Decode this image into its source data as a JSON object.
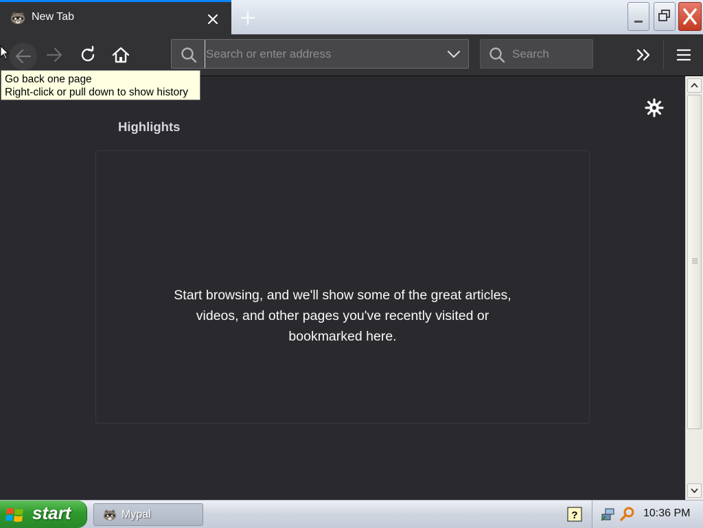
{
  "tab": {
    "title": "New Tab"
  },
  "navbar": {
    "url_placeholder": "Search or enter address",
    "search_placeholder": "Search"
  },
  "tooltip": {
    "line1": "Go back one page",
    "line2": "Right-click or pull down to show history"
  },
  "content": {
    "section_title": "Highlights",
    "empty_message_line1": "Start browsing, and we'll show some of the great articles,",
    "empty_message_line2": "videos, and other pages you've recently visited or",
    "empty_message_line3": "bookmarked here."
  },
  "taskbar": {
    "start_label": "start",
    "task_label": "Mypal",
    "clock": "10:36 PM"
  },
  "colors": {
    "accent": "#0a84ff",
    "content_bg": "#2a2a2e",
    "toolbar_bg": "#323234"
  }
}
